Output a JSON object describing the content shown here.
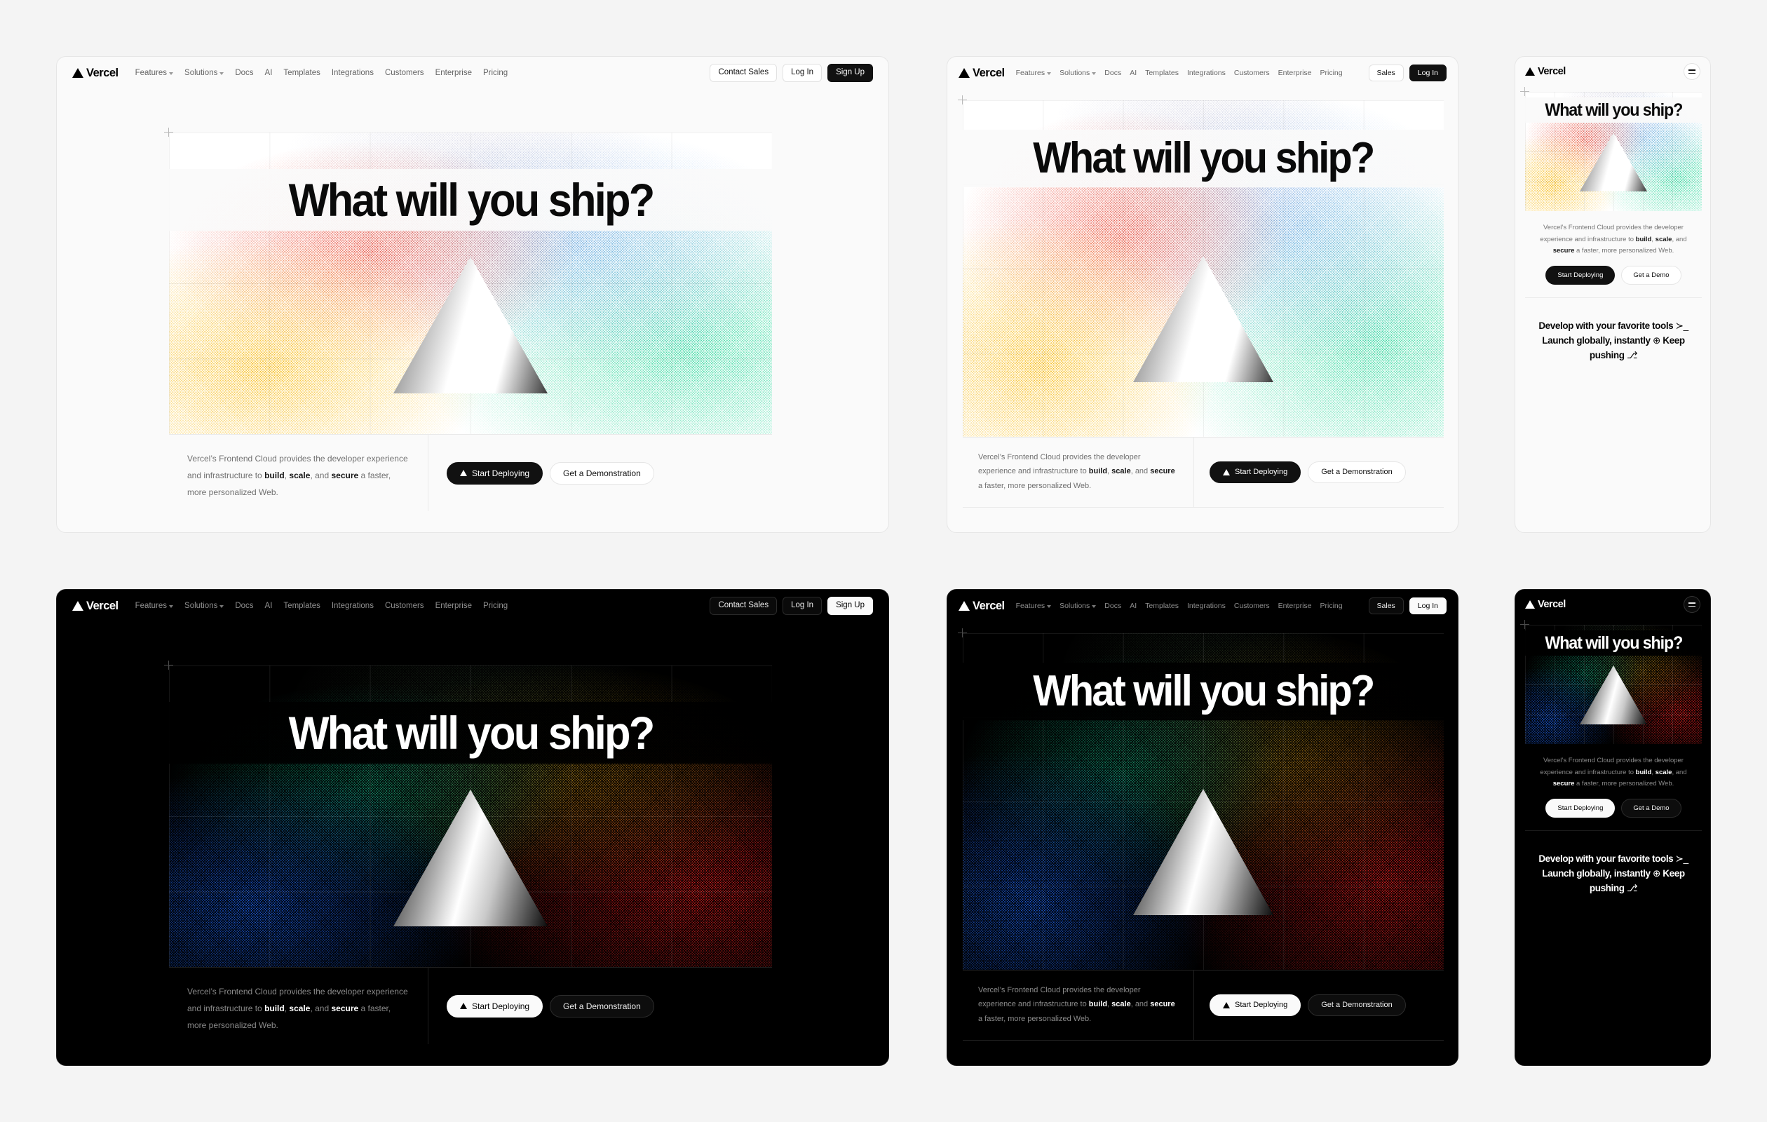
{
  "page": {
    "background_color": "#f4f4f4",
    "light_surface": "#fafafa",
    "dark_surface": "#000000"
  },
  "brand": {
    "name": "Vercel",
    "logo_icon": "triangle-logo-icon"
  },
  "nav": {
    "links": [
      {
        "label": "Features",
        "has_caret": true
      },
      {
        "label": "Solutions",
        "has_caret": true
      },
      {
        "label": "Docs",
        "has_caret": false
      },
      {
        "label": "AI",
        "has_caret": false
      },
      {
        "label": "Templates",
        "has_caret": false
      },
      {
        "label": "Integrations",
        "has_caret": false
      },
      {
        "label": "Customers",
        "has_caret": false
      },
      {
        "label": "Enterprise",
        "has_caret": false
      },
      {
        "label": "Pricing",
        "has_caret": false
      }
    ],
    "actions_desktop": [
      {
        "label": "Contact Sales",
        "style": "ghost"
      },
      {
        "label": "Log In",
        "style": "ghost"
      },
      {
        "label": "Sign Up",
        "style": "primary"
      }
    ],
    "actions_tablet": [
      {
        "label": "Sales",
        "style": "ghost"
      },
      {
        "label": "Log In",
        "style": "primary"
      }
    ],
    "menu_icon": "hamburger-menu-icon"
  },
  "hero": {
    "headline": "What will you ship?",
    "triangle_icon": "gradient-triangle-graphic",
    "crosshair_icon": "crosshair-marker-icon"
  },
  "copy": {
    "lead": "Vercel’s Frontend Cloud provides the developer experience and infrastructure to ",
    "bold_1": "build",
    "sep_1": ", ",
    "bold_2": "scale",
    "sep_2": ", and ",
    "bold_3": "secure",
    "tail": " a faster, more personalized Web."
  },
  "ctas": {
    "primary": {
      "label": "Start Deploying",
      "icon": "triangle-logo-icon"
    },
    "secondary_desktop": {
      "label": "Get a Demonstration"
    },
    "secondary_mobile": {
      "label": "Get a Demo"
    }
  },
  "marquee": {
    "part_1": "Develop with your favorite tools",
    "icon_1": "terminal-prompt-icon",
    "glyph_1": "≻_",
    "part_2": "Launch globally, instantly",
    "icon_2": "globe-icon",
    "glyph_2": "⊕",
    "part_3": "Keep pushing",
    "icon_3": "git-branch-icon",
    "glyph_3": "⎇"
  },
  "variants": [
    {
      "id": "desktop-light",
      "device": "desktop",
      "theme": "light"
    },
    {
      "id": "tablet-light",
      "device": "tablet",
      "theme": "light"
    },
    {
      "id": "mobile-light",
      "device": "mobile",
      "theme": "light"
    },
    {
      "id": "desktop-dark",
      "device": "desktop",
      "theme": "dark"
    },
    {
      "id": "tablet-dark",
      "device": "tablet",
      "theme": "dark"
    },
    {
      "id": "mobile-dark",
      "device": "mobile",
      "theme": "dark"
    }
  ]
}
